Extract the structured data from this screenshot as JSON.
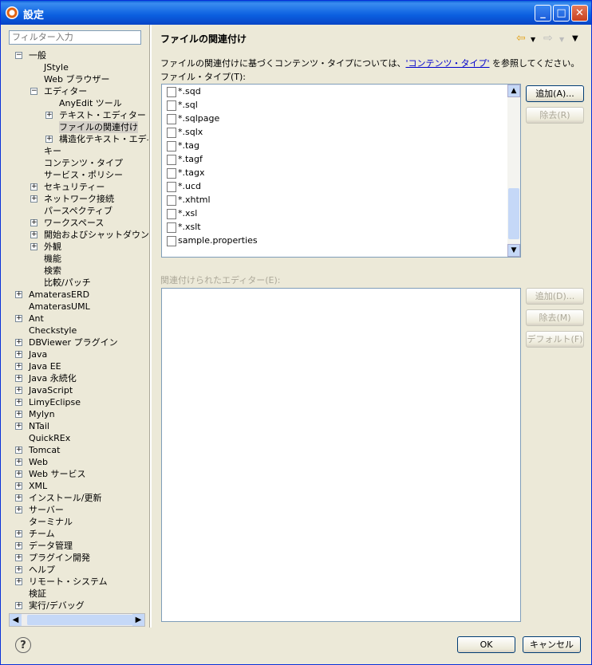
{
  "window": {
    "title": "設定",
    "min": "_",
    "max": "□",
    "close": "✕"
  },
  "filter": {
    "placeholder": "フィルター入力"
  },
  "tree": [
    {
      "label": "一般",
      "lvl": 0,
      "exp": "-"
    },
    {
      "label": "JStyle",
      "lvl": 1,
      "exp": ""
    },
    {
      "label": "Web ブラウザー",
      "lvl": 1,
      "exp": ""
    },
    {
      "label": "エディター",
      "lvl": 1,
      "exp": "-"
    },
    {
      "label": "AnyEdit ツール",
      "lvl": 2,
      "exp": ""
    },
    {
      "label": "テキスト・エディター",
      "lvl": 2,
      "exp": "+"
    },
    {
      "label": "ファイルの関連付け",
      "lvl": 2,
      "exp": "",
      "sel": true
    },
    {
      "label": "構造化テキスト・エディ",
      "lvl": 2,
      "exp": "+"
    },
    {
      "label": "キー",
      "lvl": 1,
      "exp": ""
    },
    {
      "label": "コンテンツ・タイプ",
      "lvl": 1,
      "exp": ""
    },
    {
      "label": "サービス・ポリシー",
      "lvl": 1,
      "exp": ""
    },
    {
      "label": "セキュリティー",
      "lvl": 1,
      "exp": "+"
    },
    {
      "label": "ネットワーク接続",
      "lvl": 1,
      "exp": "+"
    },
    {
      "label": "パースペクティブ",
      "lvl": 1,
      "exp": ""
    },
    {
      "label": "ワークスペース",
      "lvl": 1,
      "exp": "+"
    },
    {
      "label": "開始およびシャットダウン",
      "lvl": 1,
      "exp": "+"
    },
    {
      "label": "外観",
      "lvl": 1,
      "exp": "+"
    },
    {
      "label": "機能",
      "lvl": 1,
      "exp": ""
    },
    {
      "label": "検索",
      "lvl": 1,
      "exp": ""
    },
    {
      "label": "比較/パッチ",
      "lvl": 1,
      "exp": ""
    },
    {
      "label": "AmaterasERD",
      "lvl": 0,
      "exp": "+"
    },
    {
      "label": "AmaterasUML",
      "lvl": 0,
      "exp": ""
    },
    {
      "label": "Ant",
      "lvl": 0,
      "exp": "+"
    },
    {
      "label": "Checkstyle",
      "lvl": 0,
      "exp": ""
    },
    {
      "label": "DBViewer プラグイン",
      "lvl": 0,
      "exp": "+"
    },
    {
      "label": "Java",
      "lvl": 0,
      "exp": "+"
    },
    {
      "label": "Java EE",
      "lvl": 0,
      "exp": "+"
    },
    {
      "label": "Java 永続化",
      "lvl": 0,
      "exp": "+"
    },
    {
      "label": "JavaScript",
      "lvl": 0,
      "exp": "+"
    },
    {
      "label": "LimyEclipse",
      "lvl": 0,
      "exp": "+"
    },
    {
      "label": "Mylyn",
      "lvl": 0,
      "exp": "+"
    },
    {
      "label": "NTail",
      "lvl": 0,
      "exp": "+"
    },
    {
      "label": "QuickREx",
      "lvl": 0,
      "exp": ""
    },
    {
      "label": "Tomcat",
      "lvl": 0,
      "exp": "+"
    },
    {
      "label": "Web",
      "lvl": 0,
      "exp": "+"
    },
    {
      "label": "Web サービス",
      "lvl": 0,
      "exp": "+"
    },
    {
      "label": "XML",
      "lvl": 0,
      "exp": "+"
    },
    {
      "label": "インストール/更新",
      "lvl": 0,
      "exp": "+"
    },
    {
      "label": "サーバー",
      "lvl": 0,
      "exp": "+"
    },
    {
      "label": "ターミナル",
      "lvl": 0,
      "exp": ""
    },
    {
      "label": "チーム",
      "lvl": 0,
      "exp": "+"
    },
    {
      "label": "データ管理",
      "lvl": 0,
      "exp": "+"
    },
    {
      "label": "プラグイン開発",
      "lvl": 0,
      "exp": "+"
    },
    {
      "label": "ヘルプ",
      "lvl": 0,
      "exp": "+"
    },
    {
      "label": "リモート・システム",
      "lvl": 0,
      "exp": "+"
    },
    {
      "label": "検証",
      "lvl": 0,
      "exp": ""
    },
    {
      "label": "実行/デバッグ",
      "lvl": 0,
      "exp": "+"
    }
  ],
  "page": {
    "title": "ファイルの関連付け",
    "desc_pre": "ファイルの関連付けに基づくコンテンツ・タイプについては、",
    "desc_link": "'コンテンツ・タイプ'",
    "desc_post": " を参照してください。",
    "filetype_label": "ファイル・タイプ(T):",
    "editors_label": "関連付けられたエディター(E):"
  },
  "files": [
    "*.sqd",
    "*.sql",
    "*.sqlpage",
    "*.sqlx",
    "*.tag",
    "*.tagf",
    "*.tagx",
    "*.ucd",
    "*.xhtml",
    "*.xsl",
    "*.xslt",
    "sample.properties"
  ],
  "buttons": {
    "add1": "追加(A)...",
    "remove1": "除去(R)",
    "add2": "追加(D)...",
    "remove2": "除去(M)",
    "default": "デフォルト(F)",
    "ok": "OK",
    "cancel": "キャンセル"
  },
  "help": "?"
}
